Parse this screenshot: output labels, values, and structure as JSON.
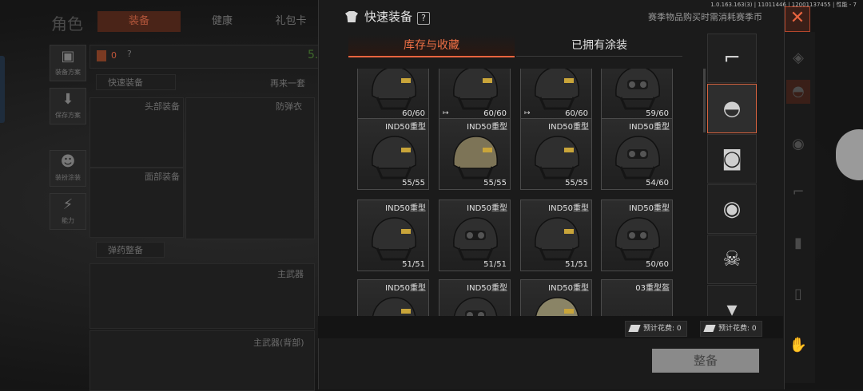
{
  "background": {
    "title": "角色",
    "tabs": [
      "装备",
      "健康",
      "礼包卡"
    ],
    "active_tab": "装备",
    "side_buttons": [
      "装备方案",
      "保存方案",
      "装扮涂装",
      "能力"
    ],
    "money_value": "0",
    "green_value": "5.",
    "quick_equip": "快速装备",
    "repeat_set": "再来一套",
    "slots": [
      "头部装备",
      "防弹衣",
      "面部装备",
      "主武器",
      "主武器(背部)"
    ],
    "ammo_btn": "弹药整备"
  },
  "version_text": "1.0.163.163(3) | 11011446 | 12001137455 | 性能 - 7",
  "modal": {
    "title": "快速装备",
    "help": "?",
    "note": "赛季物品购买时需消耗赛季币",
    "close": "✕",
    "tabs": [
      "库存与收藏",
      "已拥有涂装"
    ],
    "items": [
      {
        "name": "",
        "durability": "60/60",
        "flag": ""
      },
      {
        "name": "",
        "durability": "60/60",
        "flag": "↦"
      },
      {
        "name": "",
        "durability": "60/60",
        "flag": "↦"
      },
      {
        "name": "",
        "durability": "59/60",
        "flag": ""
      },
      {
        "name": "IND50重型",
        "durability": "55/55",
        "flag": ""
      },
      {
        "name": "IND50重型",
        "durability": "55/55",
        "flag": ""
      },
      {
        "name": "IND50重型",
        "durability": "55/55",
        "flag": ""
      },
      {
        "name": "IND50重型",
        "durability": "54/60",
        "flag": ""
      },
      {
        "name": "IND50重型",
        "durability": "51/51",
        "flag": ""
      },
      {
        "name": "IND50重型",
        "durability": "51/51",
        "flag": ""
      },
      {
        "name": "IND50重型",
        "durability": "51/51",
        "flag": ""
      },
      {
        "name": "IND50重型",
        "durability": "50/60",
        "flag": ""
      },
      {
        "name": "IND50重型",
        "durability": "",
        "flag": ""
      },
      {
        "name": "IND50重型",
        "durability": "",
        "flag": ""
      },
      {
        "name": "IND50重型",
        "durability": "",
        "flag": ""
      },
      {
        "name": "03重型盔",
        "durability": "",
        "flag": ""
      }
    ],
    "categories": [
      "rifle-icon",
      "helmet-icon",
      "mask-icon",
      "night-vision-icon",
      "gas-mask-icon",
      "vest-icon"
    ],
    "selected_category": "helmet-icon",
    "cost_labels": [
      "预计花费: 0",
      "预计花费: 0"
    ],
    "equip_button": "整备"
  },
  "colors": {
    "accent": "#e8643f",
    "tan_helmet": "#7d7457",
    "dark_helmet": "#2f2f2f"
  }
}
